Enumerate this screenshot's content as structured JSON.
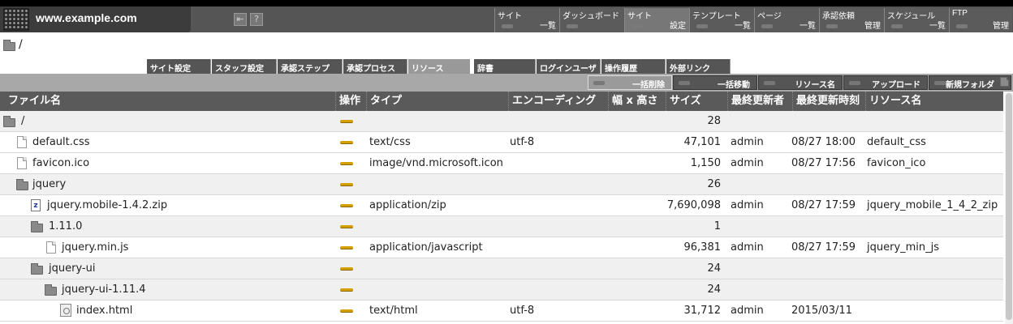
{
  "header": {
    "site_url": "www.example.com",
    "help_icon": "?",
    "menu": [
      {
        "line1": "サイト",
        "line2": "一覧"
      },
      {
        "line1": "ダッシュボード",
        "line2": ""
      },
      {
        "line1": "サイト",
        "line2": "設定"
      },
      {
        "line1": "テンプレート",
        "line2": "一覧"
      },
      {
        "line1": "ページ",
        "line2": "一覧"
      },
      {
        "line1": "承認依頼",
        "line2": "管理"
      },
      {
        "line1": "スケジュール",
        "line2": "一覧"
      },
      {
        "line1": "FTP",
        "line2": "管理"
      }
    ]
  },
  "path": "/",
  "tabs": [
    "サイト設定",
    "スタッフ設定",
    "承認ステップ",
    "承認プロセス",
    "リソース",
    "辞書",
    "ログインユーザ",
    "操作履歴",
    "外部リンク"
  ],
  "actions": [
    "一括削除",
    "一括移動",
    "リソース名",
    "アップロード",
    "新規フォルダ"
  ],
  "columns": [
    "ファイル名",
    "操作",
    "タイプ",
    "エンコーディング",
    "幅 x 高さ",
    "サイズ",
    "最終更新者",
    "最終更新時刻",
    "リソース名"
  ],
  "rows": [
    {
      "name": "/",
      "kind": "folder",
      "type": "",
      "encoding": "",
      "size": "28",
      "updater": "",
      "updated": "",
      "resource": ""
    },
    {
      "name": "default.css",
      "kind": "file",
      "type": "text/css",
      "encoding": "utf-8",
      "size": "47,101",
      "updater": "admin",
      "updated": "08/27 18:00",
      "resource": "default_css"
    },
    {
      "name": "favicon.ico",
      "kind": "file",
      "type": "image/vnd.microsoft.icon",
      "encoding": "",
      "size": "1,150",
      "updater": "admin",
      "updated": "08/27 17:56",
      "resource": "favicon_ico"
    },
    {
      "name": "jquery",
      "kind": "folder",
      "type": "",
      "encoding": "",
      "size": "26",
      "updater": "",
      "updated": "",
      "resource": ""
    },
    {
      "name": "jquery.mobile-1.4.2.zip",
      "kind": "zip",
      "type": "application/zip",
      "encoding": "",
      "size": "7,690,098",
      "updater": "admin",
      "updated": "08/27 17:59",
      "resource": "jquery_mobile_1_4_2_zip"
    },
    {
      "name": "1.11.0",
      "kind": "folder",
      "type": "",
      "encoding": "",
      "size": "1",
      "updater": "",
      "updated": "",
      "resource": ""
    },
    {
      "name": "jquery.min.js",
      "kind": "file",
      "type": "application/javascript",
      "encoding": "",
      "size": "96,381",
      "updater": "admin",
      "updated": "08/27 17:59",
      "resource": "jquery_min_js"
    },
    {
      "name": "jquery-ui",
      "kind": "folder",
      "type": "",
      "encoding": "",
      "size": "24",
      "updater": "",
      "updated": "",
      "resource": ""
    },
    {
      "name": "jquery-ui-1.11.4",
      "kind": "folder",
      "type": "",
      "encoding": "",
      "size": "24",
      "updater": "",
      "updated": "",
      "resource": ""
    },
    {
      "name": "index.html",
      "kind": "html",
      "type": "text/html",
      "encoding": "utf-8",
      "size": "31,712",
      "updater": "admin",
      "updated": "2015/03/11",
      "resource": ""
    }
  ]
}
